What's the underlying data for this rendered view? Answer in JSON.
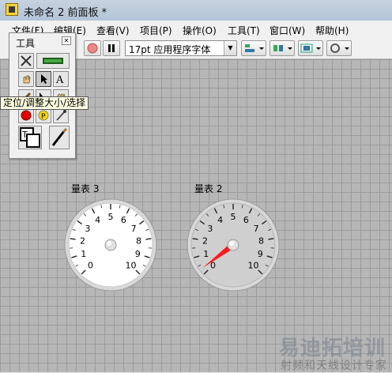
{
  "window": {
    "title": "未命名 2 前面板 *"
  },
  "menu": [
    "文件(F)",
    "编辑(E)",
    "查看(V)",
    "项目(P)",
    "操作(O)",
    "工具(T)",
    "窗口(W)",
    "帮助(H)"
  ],
  "toolbar": {
    "font_select_value": "17pt 应用程序字体"
  },
  "tools_palette": {
    "title": "工具",
    "tooltip": "定位/调整大小/选择"
  },
  "gauges": [
    {
      "label": "量表 3",
      "min": 0,
      "max": 10,
      "value": 0,
      "ticks": [
        "0",
        "1",
        "2",
        "3",
        "4",
        "5",
        "6",
        "7",
        "8",
        "9",
        "10"
      ]
    },
    {
      "label": "量表 2",
      "min": 0,
      "max": 10,
      "value": 0.3,
      "ticks": [
        "0",
        "1",
        "2",
        "3",
        "4",
        "5",
        "6",
        "7",
        "8",
        "9",
        "10"
      ]
    }
  ],
  "watermark": {
    "line1": "易迪拓培训",
    "line2": "射频和天线设计专家"
  },
  "colors": {
    "needle": "#ff1a1a",
    "canvas": "#b6b6b6"
  }
}
